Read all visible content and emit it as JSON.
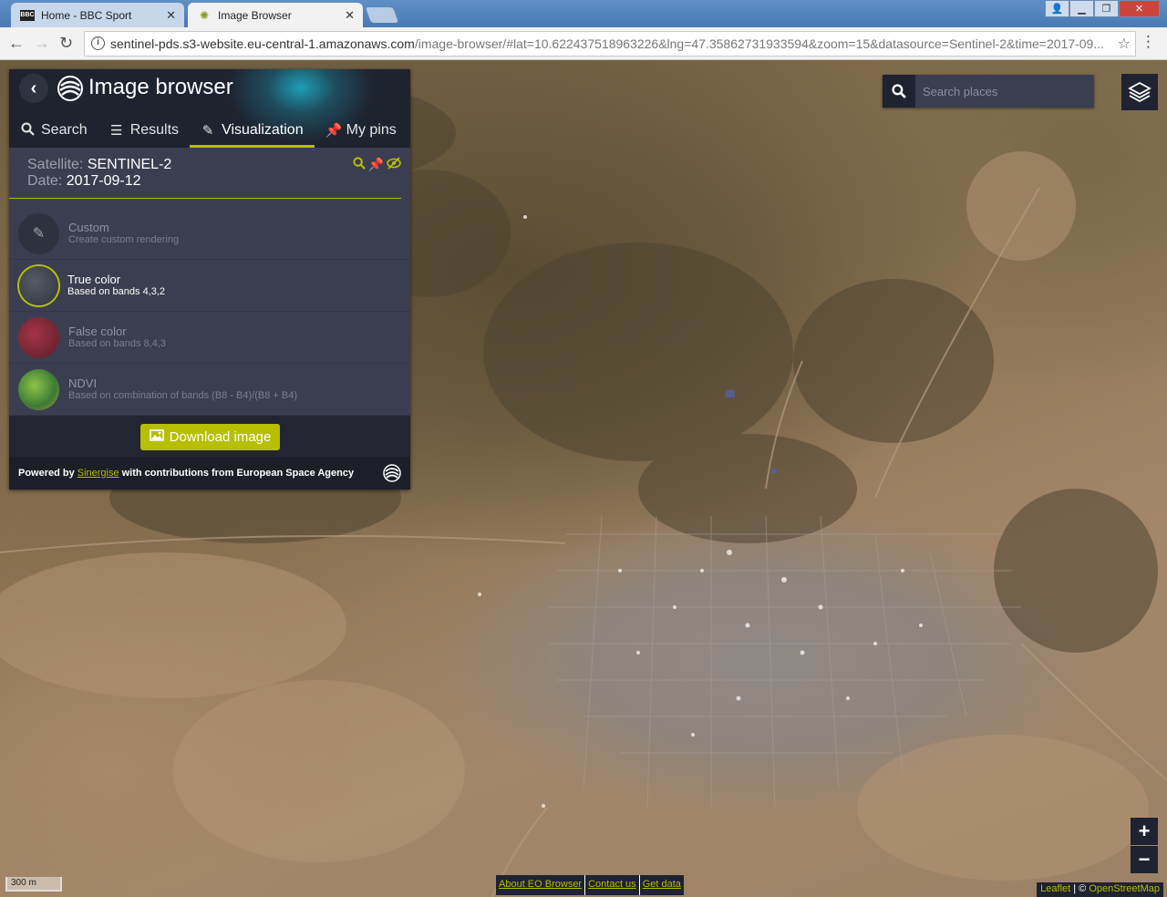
{
  "browser": {
    "tabs": [
      {
        "title": "Home - BBC Sport",
        "favicon": "BBC"
      },
      {
        "title": "Image Browser",
        "favicon": "sinergise-logo"
      }
    ],
    "url_main": "sentinel-pds.s3-website.eu-central-1.amazonaws.com",
    "url_rest": "/image-browser/#lat=10.622437518963226&lng=47.35862731933594&zoom=15&datasource=Sentinel-2&time=2017-09..."
  },
  "panel": {
    "title": "Image browser",
    "tabs": [
      {
        "label": "Search",
        "icon": "search-icon"
      },
      {
        "label": "Results",
        "icon": "sliders-icon"
      },
      {
        "label": "Visualization",
        "icon": "brush-icon",
        "active": true
      },
      {
        "label": "My pins",
        "icon": "pin-icon"
      }
    ],
    "satellite_label": "Satellite:",
    "satellite_value": "SENTINEL-2",
    "date_label": "Date:",
    "date_value": "2017-09-12",
    "visualizations": [
      {
        "name": "Custom",
        "desc": "Create custom rendering"
      },
      {
        "name": "True color",
        "desc": "Based on bands 4,3,2",
        "selected": true
      },
      {
        "name": "False color",
        "desc": "Based on bands 8,4,3"
      },
      {
        "name": "NDVI",
        "desc": "Based on combination of bands (B8 - B4)/(B8 + B4)"
      }
    ],
    "download_label": "Download image",
    "footer_prefix": "Powered by",
    "footer_link": "Sinergise",
    "footer_suffix": "with contributions from European Space Agency"
  },
  "map": {
    "search_placeholder": "Search places",
    "zoom_in": "+",
    "zoom_out": "−",
    "scale_label": "300 m",
    "bottom_links": [
      "About EO Browser",
      "Contact us",
      "Get data"
    ],
    "attribution_leaflet": "Leaflet",
    "attribution_sep": " | © ",
    "attribution_osm": "OpenStreetMap"
  },
  "colors": {
    "accent": "#b6bf00",
    "panel_bg": "#3b3e50",
    "panel_dark": "#1f2230"
  }
}
